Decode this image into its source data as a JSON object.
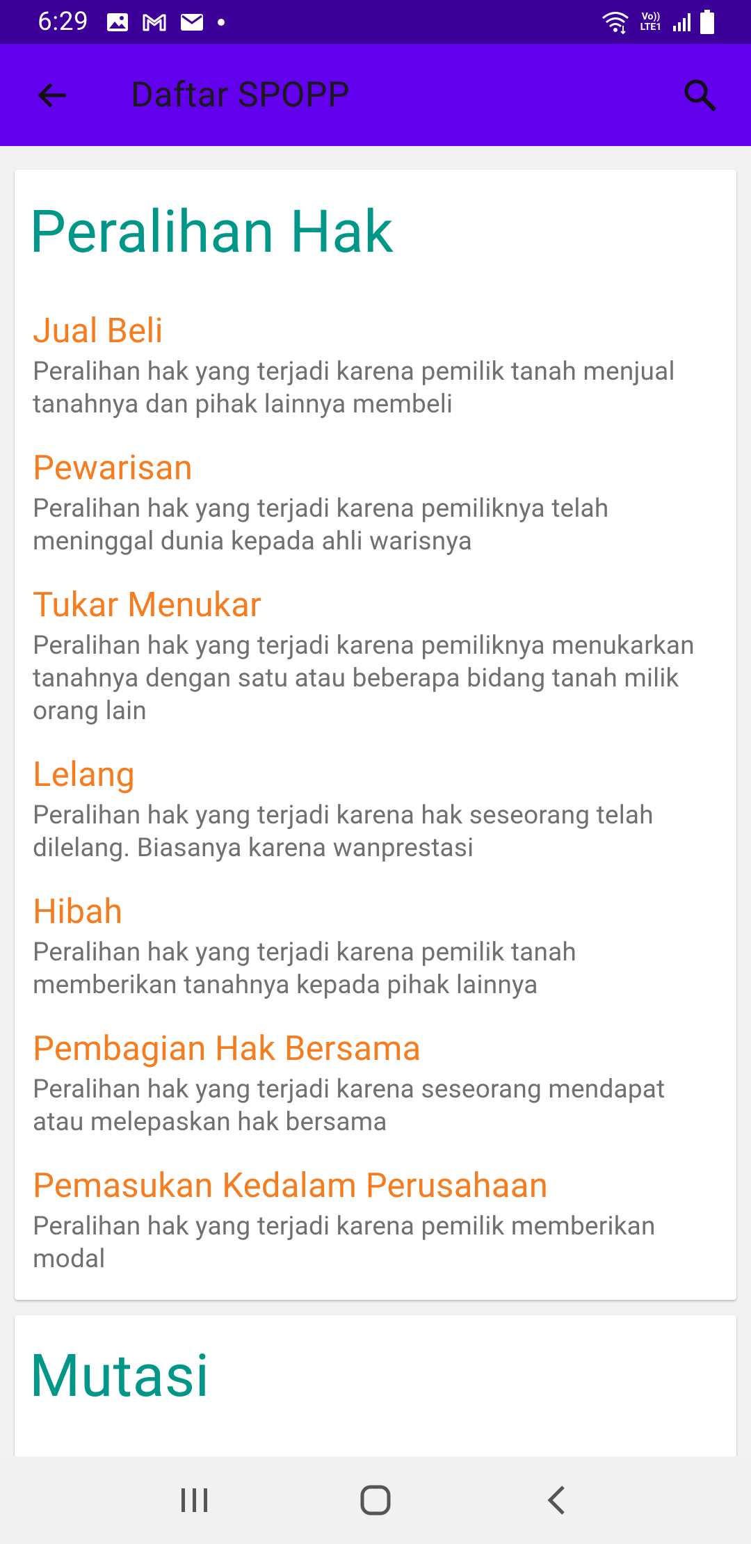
{
  "status_bar": {
    "time": "6:29",
    "lte_label": "Vo)) LTE1",
    "icons": [
      "image-icon",
      "gmail-icon",
      "mail-icon",
      "dot-icon",
      "wifi-icon",
      "signal-icon",
      "battery-icon"
    ]
  },
  "app_bar": {
    "title": "Daftar SPOPP",
    "back_icon": "arrow-back-icon",
    "search_icon": "search-icon"
  },
  "sections": [
    {
      "title": "Peralihan Hak",
      "items": [
        {
          "title": "Jual Beli",
          "description": "Peralihan hak yang terjadi karena pemilik tanah menjual tanahnya dan pihak lainnya membeli"
        },
        {
          "title": "Pewarisan",
          "description": "Peralihan hak yang terjadi karena pemiliknya telah meninggal dunia kepada ahli warisnya"
        },
        {
          "title": "Tukar Menukar",
          "description": "Peralihan hak yang terjadi karena pemiliknya menukarkan tanahnya dengan satu atau beberapa bidang tanah milik orang lain"
        },
        {
          "title": "Lelang",
          "description": "Peralihan hak yang terjadi karena hak seseorang telah dilelang. Biasanya karena wanprestasi"
        },
        {
          "title": "Hibah",
          "description": "Peralihan hak yang terjadi karena pemilik tanah memberikan tanahnya kepada pihak lainnya"
        },
        {
          "title": "Pembagian Hak Bersama",
          "description": "Peralihan hak yang terjadi karena seseorang mendapat atau melepaskan hak bersama"
        },
        {
          "title": "Pemasukan Kedalam Perusahaan",
          "description": "Peralihan hak yang terjadi karena pemilik memberikan modal"
        }
      ]
    },
    {
      "title": "Mutasi",
      "items": []
    }
  ],
  "nav_bar": {
    "buttons": [
      "recent-apps-icon",
      "home-icon",
      "back-icon"
    ]
  },
  "colors": {
    "status_bar": "#3c0099",
    "app_bar": "#6200ee",
    "section_title": "#009688",
    "item_title": "#f57c1f",
    "item_description": "#707070"
  }
}
